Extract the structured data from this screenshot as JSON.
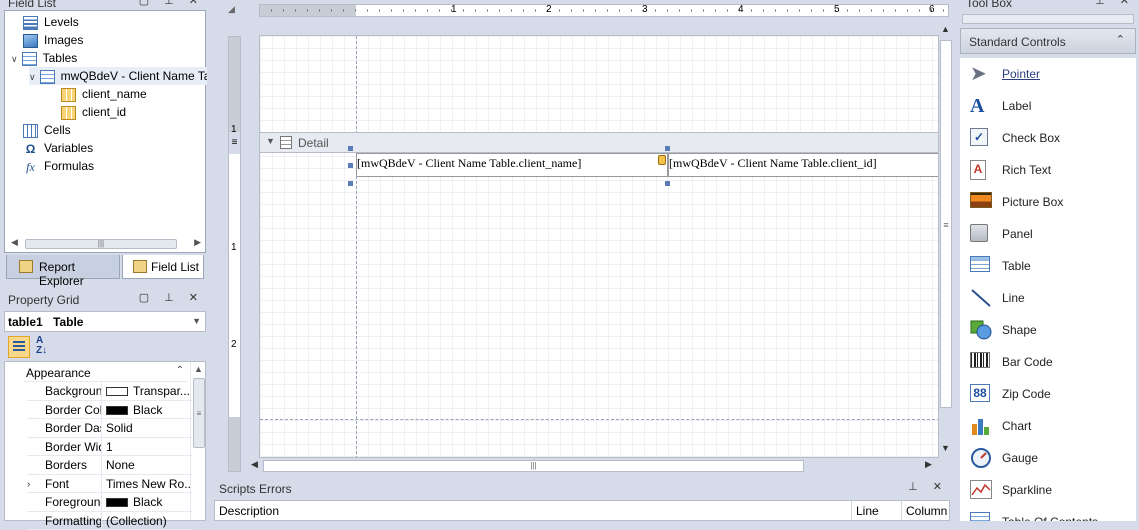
{
  "field_list": {
    "title": "Field List",
    "items": {
      "levels": "Levels",
      "images": "Images",
      "tables": "Tables",
      "table_name": "mwQBdeV - Client Name Table",
      "col1": "client_name",
      "col2": "client_id",
      "cells": "Cells",
      "variables": "Variables",
      "formulas": "Formulas"
    },
    "tabs": {
      "report_explorer": "Report Explorer",
      "field_list": "Field List"
    }
  },
  "property_grid": {
    "title": "Property Grid",
    "selected_name": "table1",
    "selected_type": "Table",
    "category": "Appearance",
    "rows": [
      {
        "key": "Background",
        "value": "Transpar...",
        "swatch": "#ffffff"
      },
      {
        "key": "Border Color",
        "value": "Black",
        "swatch": "#000000"
      },
      {
        "key": "Border Dash",
        "value": "Solid",
        "swatch": ""
      },
      {
        "key": "Border Width",
        "value": "1",
        "swatch": ""
      },
      {
        "key": "Borders",
        "value": "None",
        "swatch": ""
      },
      {
        "key": "Font",
        "value": "Times New Ro...",
        "swatch": ""
      },
      {
        "key": "Foreground",
        "value": "Black",
        "swatch": "#000000"
      },
      {
        "key": "Formatting",
        "value": "(Collection)",
        "swatch": ""
      }
    ]
  },
  "designer": {
    "ruler_labels": [
      "1",
      "2",
      "3",
      "4",
      "5",
      "6"
    ],
    "vruler_labels": [
      "1",
      "1",
      "2"
    ],
    "band_label": "Detail",
    "cell1": "[mwQBdeV - Client Name Table.client_name]",
    "cell2": "[mwQBdeV - Client Name Table.client_id]"
  },
  "scripts": {
    "title": "Scripts Errors",
    "columns": {
      "description": "Description",
      "line": "Line",
      "column": "Column"
    }
  },
  "toolbox": {
    "title": "Tool Box",
    "group": "Standard Controls",
    "items": [
      "Pointer",
      "Label",
      "Check Box",
      "Rich Text",
      "Picture Box",
      "Panel",
      "Table",
      "Line",
      "Shape",
      "Bar Code",
      "Zip Code",
      "Chart",
      "Gauge",
      "Sparkline",
      "Table Of Contents"
    ]
  }
}
